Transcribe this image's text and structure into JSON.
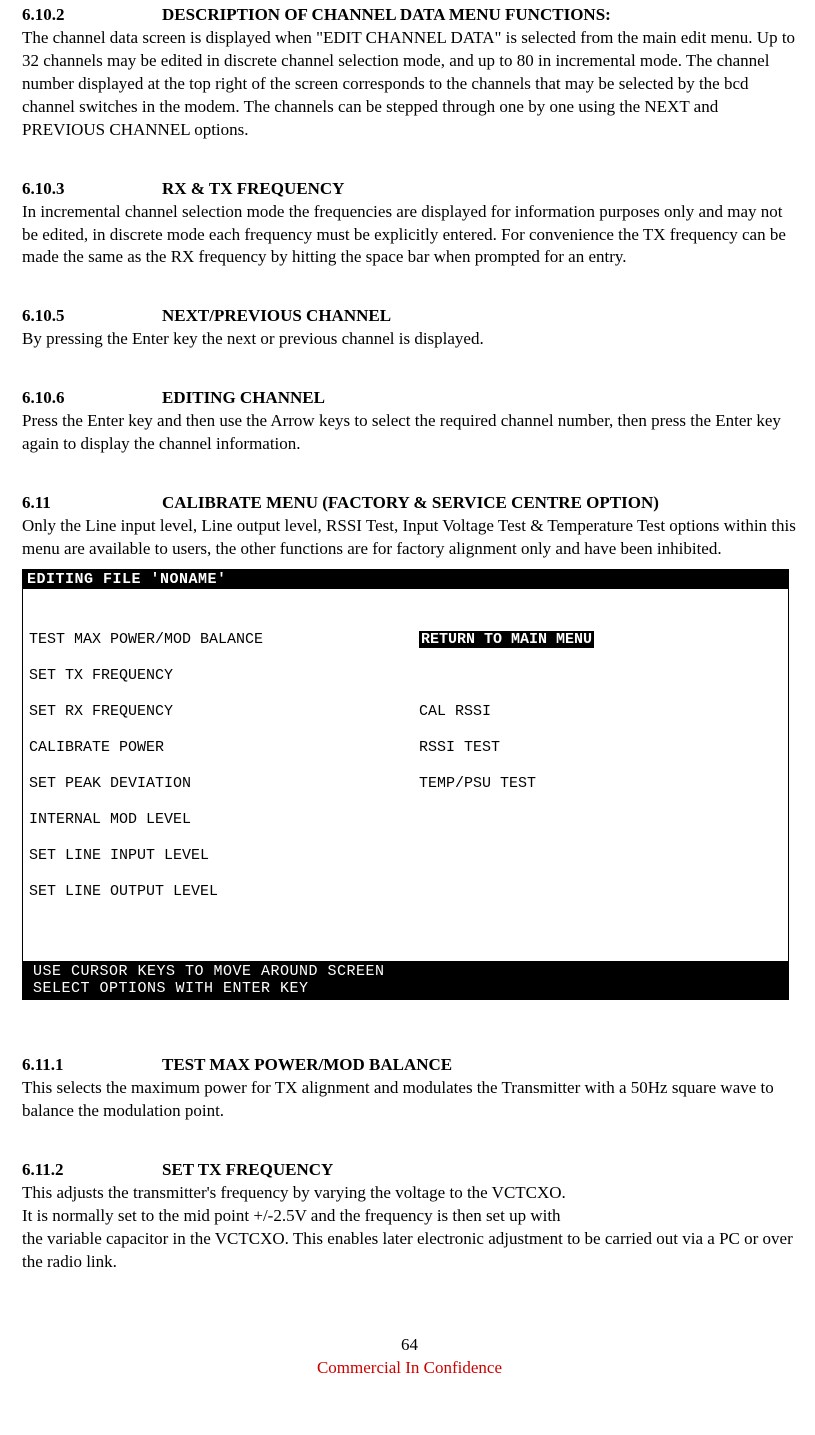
{
  "sections": {
    "s6_10_2": {
      "num": "6.10.2",
      "title": "DESCRIPTION OF CHANNEL DATA MENU FUNCTIONS:",
      "body": "The channel data screen is displayed when \"EDIT CHANNEL DATA\" is selected from the main edit menu. Up to 32 channels may be edited in discrete channel selection mode, and up to 80 in incremental mode. The channel number displayed at the top right of the screen corresponds to the channels that may be selected by the bcd channel switches in the modem. The channels can be stepped through one by one using the NEXT and PREVIOUS CHANNEL options."
    },
    "s6_10_3": {
      "num": "6.10.3",
      "title": "RX & TX FREQUENCY",
      "body": "In incremental channel selection mode the frequencies are displayed for information purposes only and may not be edited, in discrete mode each frequency must be explicitly entered. For convenience the TX frequency can be made the same as the RX frequency by hitting the space bar when prompted for an entry."
    },
    "s6_10_5": {
      "num": "6.10.5",
      "title": "NEXT/PREVIOUS CHANNEL",
      "body": "By pressing the Enter key the next or previous channel is displayed."
    },
    "s6_10_6": {
      "num": "6.10.6",
      "title": "EDITING CHANNEL",
      "body": "Press the Enter key and then use the Arrow keys to select the required channel number, then press the Enter key again to display the channel information."
    },
    "s6_11": {
      "num": "6.11",
      "title": "CALIBRATE MENU (FACTORY & SERVICE CENTRE OPTION)",
      "body": "Only the Line input level, Line output level, RSSI Test, Input Voltage Test & Temperature Test options within this menu are available to users, the other functions are for factory alignment only and have been inhibited."
    },
    "s6_11_1": {
      "num": "6.11.1",
      "title": "TEST MAX POWER/MOD BALANCE",
      "body": "This selects the maximum power for TX alignment and modulates the Transmitter with a 50Hz square wave to balance the modulation point."
    },
    "s6_11_2": {
      "num": "6.11.2",
      "title": "SET TX FREQUENCY",
      "body": "This adjusts the transmitter's frequency by varying the voltage to the VCTCXO.\nIt is normally set to the mid point +/-2.5V and the frequency is then set up with\nthe variable capacitor in the VCTCXO. This enables later electronic adjustment to be carried out via a PC or over the radio link."
    }
  },
  "terminal": {
    "title": "EDITING FILE 'NONAME'",
    "left_items": [
      "TEST MAX POWER/MOD BALANCE",
      "SET TX FREQUENCY",
      "SET RX FREQUENCY",
      "CALIBRATE POWER",
      "SET PEAK DEVIATION",
      "INTERNAL MOD LEVEL",
      "SET LINE INPUT LEVEL",
      "SET LINE OUTPUT LEVEL"
    ],
    "right_items": [
      "RETURN TO MAIN MENU",
      "",
      "CAL RSSI",
      "RSSI TEST",
      "TEMP/PSU TEST"
    ],
    "footer_line1": "USE CURSOR KEYS TO MOVE AROUND SCREEN",
    "footer_line2": "SELECT OPTIONS WITH ENTER KEY"
  },
  "footer": {
    "page_number": "64",
    "confidential": "Commercial In Confidence"
  }
}
